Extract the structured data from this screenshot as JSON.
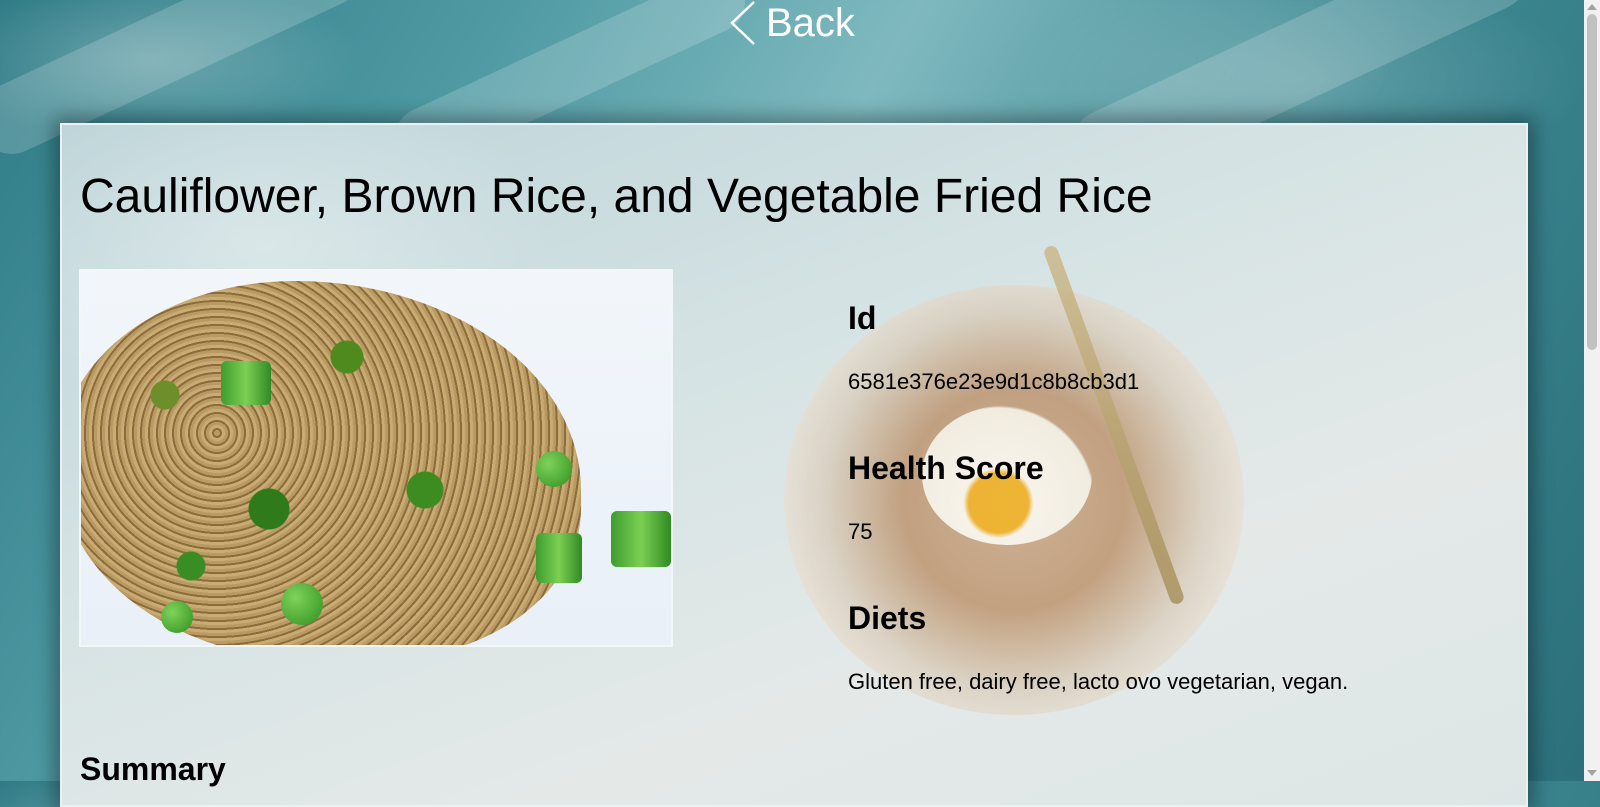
{
  "nav": {
    "back_label": "Back"
  },
  "recipe": {
    "title": "Cauliflower, Brown Rice, and Vegetable Fried Rice",
    "image_alt": "Fried rice with broccoli, peas and scallions"
  },
  "details": {
    "id_label": "Id",
    "id_value": "6581e376e23e9d1c8b8cb3d1",
    "health_label": "Health Score",
    "health_value": "75",
    "diets_label": "Diets",
    "diets_value": "Gluten free, dairy free, lacto ovo vegetarian, vegan."
  },
  "summary": {
    "heading": "Summary"
  },
  "colors": {
    "background": "#3c8791",
    "card_border": "#e9f1f2",
    "text": "#000000",
    "back_text": "#ffffff"
  },
  "icons": {
    "back": "chevron-left-icon"
  }
}
